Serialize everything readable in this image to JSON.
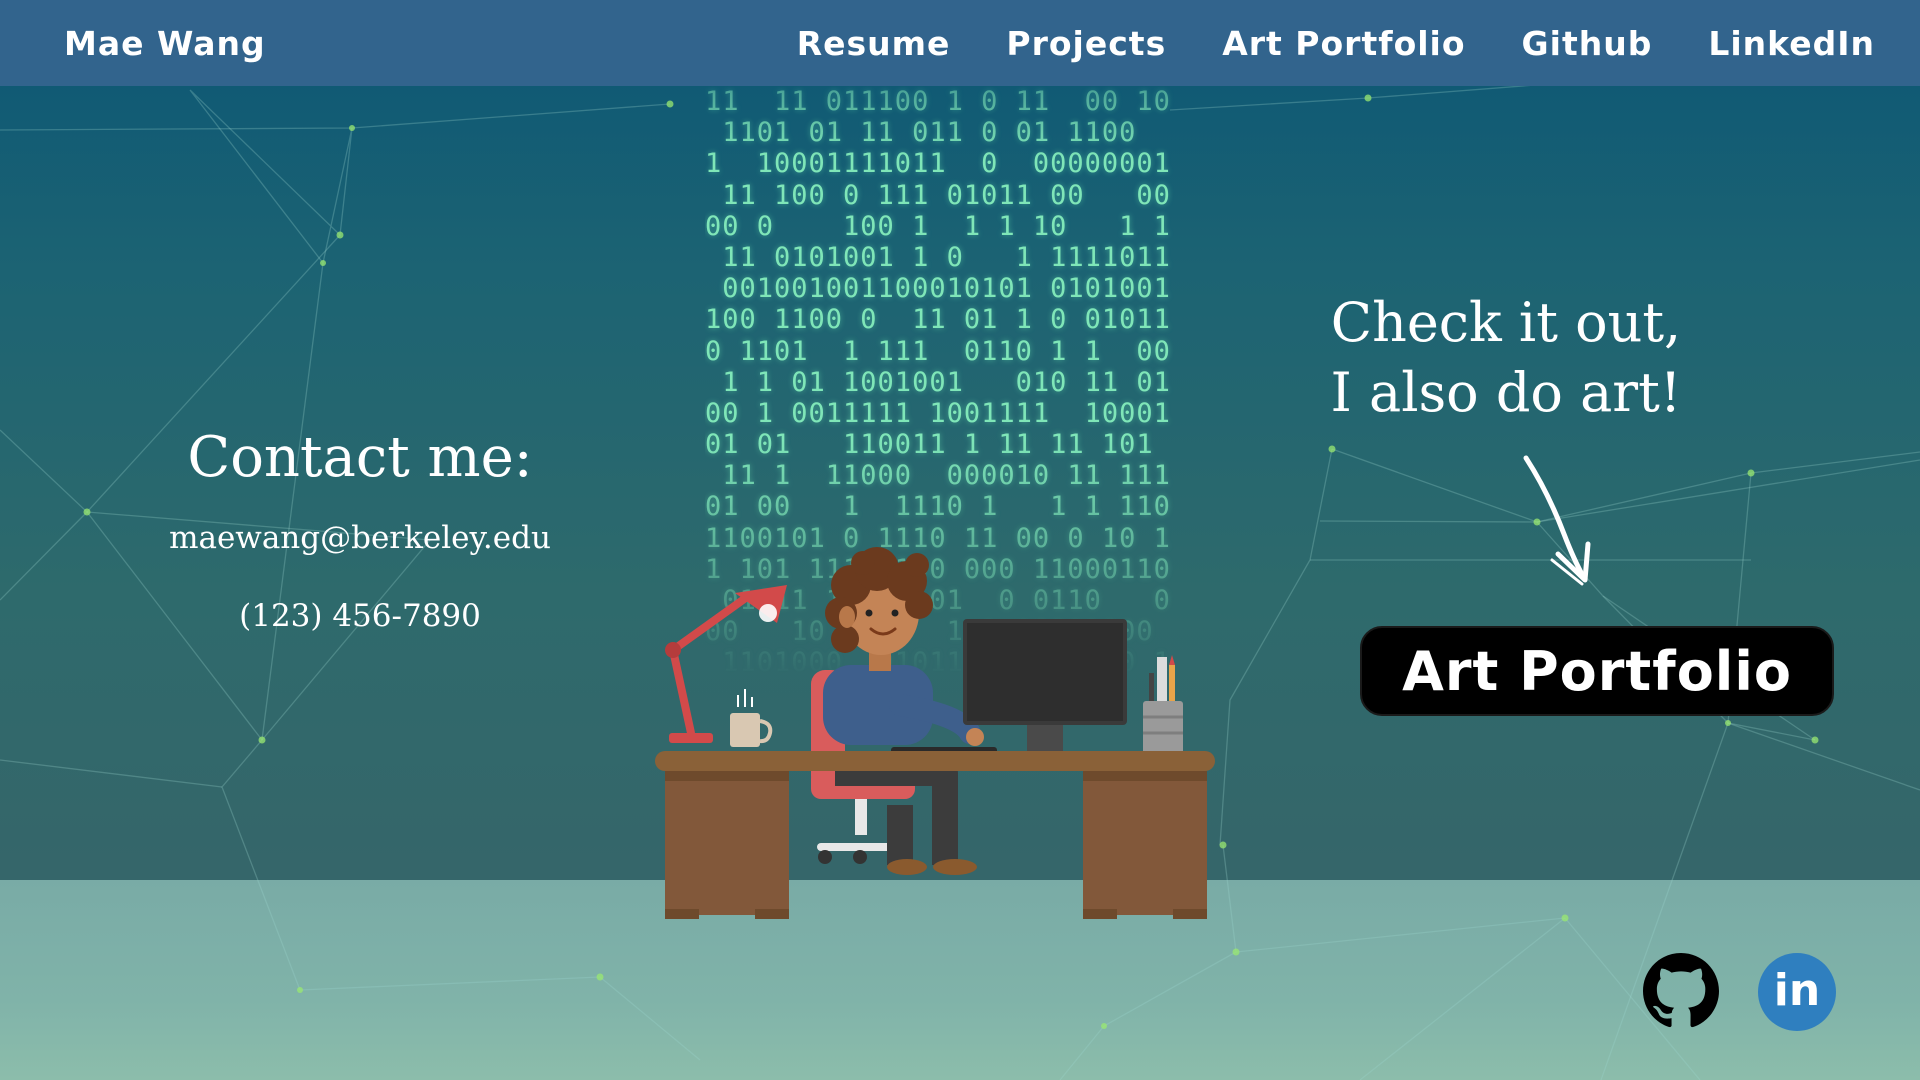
{
  "nav": {
    "brand": "Mae Wang",
    "links": [
      "Resume",
      "Projects",
      "Art Portfolio",
      "Github",
      "LinkedIn"
    ]
  },
  "contact": {
    "title": "Contact me:",
    "email": "maewang@berkeley.edu",
    "phone": "(123) 456-7890"
  },
  "art": {
    "callout_line1": "Check it out,",
    "callout_line2": "I also do art!",
    "button_label": "Art Portfolio"
  },
  "social": {
    "linkedin_label": "in"
  },
  "icons": {
    "github": "github-icon",
    "linkedin": "linkedin-icon",
    "arrow": "arrow-down-right-icon"
  },
  "colors": {
    "navbar": "#32648d",
    "background_top": "#0b5674",
    "background_bottom": "#35666a",
    "floor": "#80b3a9",
    "button": "#000000",
    "linkedin": "#2f7fbf",
    "binary": "#7fe6b8"
  }
}
